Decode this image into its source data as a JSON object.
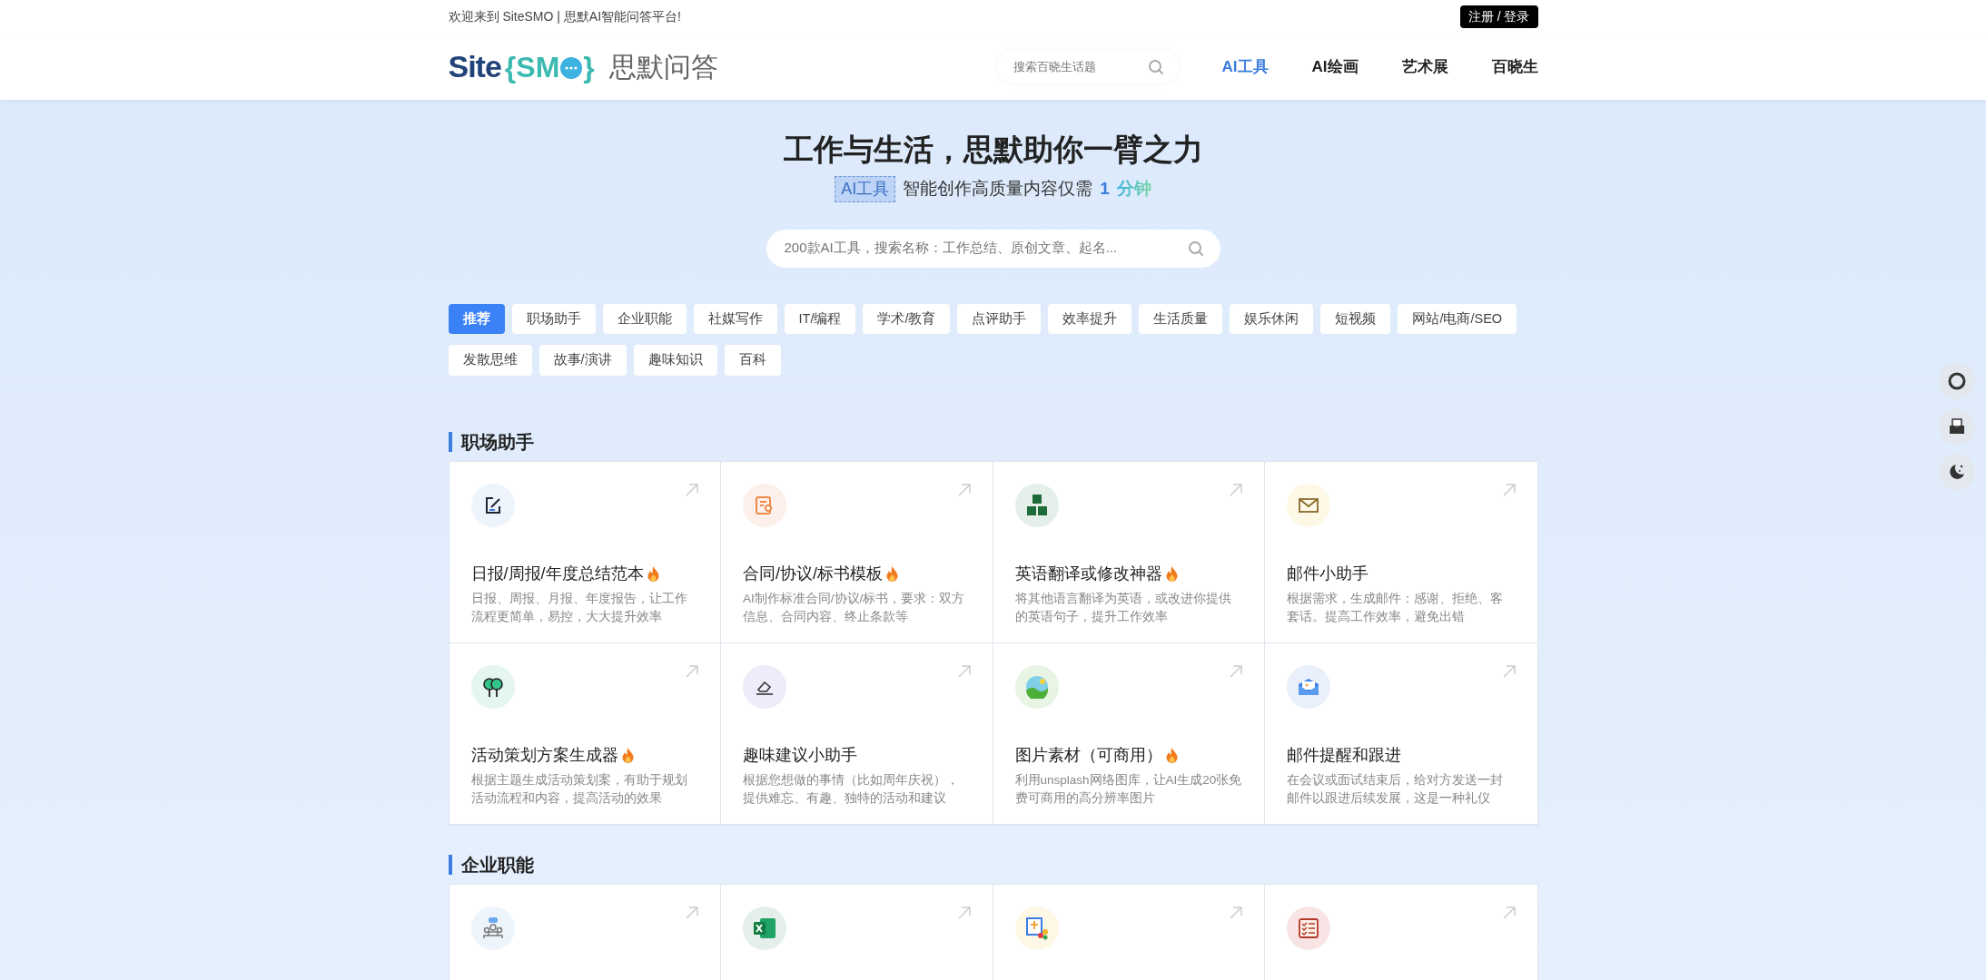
{
  "topbar": {
    "welcome": "欢迎来到 SiteSMO | 思默AI智能问答平台!",
    "login": "注册 / 登录"
  },
  "header": {
    "logo": {
      "brand": "Site",
      "mark_open": "{",
      "mark": "SM",
      "mark_close": "}",
      "name": "思默问答"
    },
    "search": {
      "placeholder": "搜索百晓生话题"
    },
    "nav": [
      {
        "label": "AI工具",
        "selected": true
      },
      {
        "label": "AI绘画",
        "selected": false
      },
      {
        "label": "艺术展",
        "selected": false
      },
      {
        "label": "百晓生",
        "selected": false
      }
    ]
  },
  "hero": {
    "title": "工作与生活，思默助你一臂之力",
    "badge": "AI工具",
    "subtitle": "智能创作高质量内容仅需",
    "number": "1",
    "unit": "分钟",
    "search": {
      "placeholder": "200款AI工具，搜索名称：工作总结、原创文章、起名..."
    }
  },
  "categories": [
    {
      "label": "推荐",
      "selected": true
    },
    {
      "label": "职场助手",
      "selected": false
    },
    {
      "label": "企业职能",
      "selected": false
    },
    {
      "label": "社媒写作",
      "selected": false
    },
    {
      "label": "IT/编程",
      "selected": false
    },
    {
      "label": "学术/教育",
      "selected": false
    },
    {
      "label": "点评助手",
      "selected": false
    },
    {
      "label": "效率提升",
      "selected": false
    },
    {
      "label": "生活质量",
      "selected": false
    },
    {
      "label": "娱乐休闲",
      "selected": false
    },
    {
      "label": "短视频",
      "selected": false
    },
    {
      "label": "网站/电商/SEO",
      "selected": false
    },
    {
      "label": "发散思维",
      "selected": false
    },
    {
      "label": "故事/演讲",
      "selected": false
    },
    {
      "label": "趣味知识",
      "selected": false
    },
    {
      "label": "百科",
      "selected": false
    }
  ],
  "sections": [
    {
      "title": "职场助手",
      "tools": [
        {
          "kind": "note",
          "title": "日报/周报/年度总结范本",
          "hot": true,
          "description": "日报、周报、月报、年度报告，让工作流程更简单，易控，大大提升效率"
        },
        {
          "kind": "contract",
          "title": "合同/协议/标书模板",
          "hot": true,
          "description": "AI制作标准合同/协议/标书，要求：双方信息、合同内容、终止条款等"
        },
        {
          "kind": "abc",
          "title": "英语翻译或修改神器",
          "hot": true,
          "description": "将其他语言翻译为英语，或改进你提供的英语句子，提升工作效率"
        },
        {
          "kind": "mail",
          "title": "邮件小助手",
          "hot": false,
          "description": "根据需求，生成邮件：感谢、拒绝、客套话。提高工作效率，避免出错"
        },
        {
          "kind": "trees",
          "title": "活动策划方案生成器",
          "hot": true,
          "description": "根据主题生成活动策划案，有助于规划活动流程和内容，提高活动的效果"
        },
        {
          "kind": "eraser",
          "title": "趣味建议小助手",
          "hot": false,
          "description": "根据您想做的事情（比如周年庆祝），提供难忘、有趣、独特的活动和建议"
        },
        {
          "kind": "landscape",
          "title": "图片素材（可商用）",
          "hot": true,
          "description": "利用unsplash网络图库，让AI生成20张免费可商用的高分辨率图片"
        },
        {
          "kind": "envelope",
          "title": "邮件提醒和跟进",
          "hot": false,
          "description": "在会议或面试结束后，给对方发送一封邮件以跟进后续发展，这是一种礼仪"
        }
      ]
    },
    {
      "title": "企业职能",
      "tools": [
        {
          "kind": "team"
        },
        {
          "kind": "excel"
        },
        {
          "kind": "chart"
        },
        {
          "kind": "checklist"
        }
      ]
    }
  ]
}
